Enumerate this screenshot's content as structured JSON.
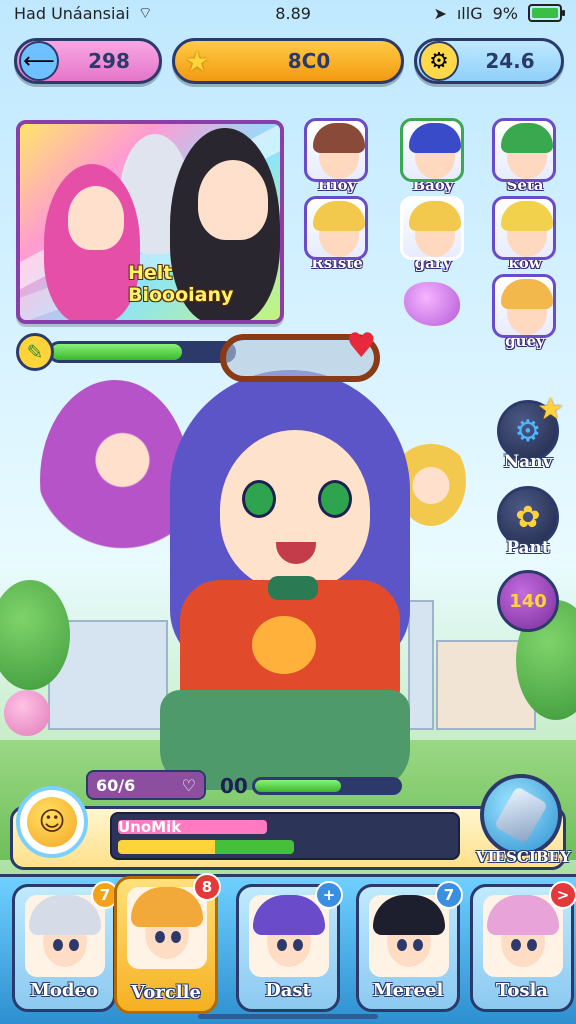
{
  "status_bar": {
    "carrier": "Had Unáansiai",
    "time": "8.89",
    "signal_text": "ıllG",
    "battery": "9%",
    "wifi_icon": "wifi-icon",
    "location_icon": "location-arrow-icon"
  },
  "resources": [
    {
      "icon": "arrow-left-icon",
      "value": "298"
    },
    {
      "icon": "star-icon",
      "value": "8C0"
    },
    {
      "icon": "gear-coin-icon",
      "value": "24.6"
    }
  ],
  "featured": {
    "caption": "Helt Bioooiany"
  },
  "roster": [
    {
      "label": "Hioy",
      "hair": "#8a4a3a",
      "border": "#6a4bc9"
    },
    {
      "label": "Baoy",
      "hair": "#3a4bc9",
      "border": "#3aa84f"
    },
    {
      "label": "Seta",
      "hair": "#3aa84f",
      "border": "#6a4bc9"
    },
    {
      "label": "Rsiste",
      "hair": "#f2c94c",
      "border": "#6a4bc9"
    },
    {
      "label": "gary",
      "hair": "#f2c94c",
      "border": "#fff"
    },
    {
      "label": "kow",
      "hair": "#f2d24c",
      "border": "#6a4bc9"
    },
    {
      "label": "guey",
      "hair": "#f2b84c",
      "border": "#6a4bc9"
    }
  ],
  "progress": {
    "fill_fraction": 0.72
  },
  "side_menu": [
    {
      "label": "Nanv",
      "icon": "gear-icon"
    },
    {
      "label": "Pant",
      "icon": "brush-icon"
    },
    {
      "label": "",
      "icon": "coin-icon",
      "coin_text": "140"
    }
  ],
  "player": {
    "hp_text": "60/6",
    "exp_num": "00",
    "exp_fill_fraction": 0.6
  },
  "quest": {
    "title": "UnoMik",
    "pink_fraction": 0.48,
    "progress_fraction": 0.55
  },
  "vs_button": {
    "label": "VIESCIBEY"
  },
  "team": [
    {
      "name": "Modeo",
      "badge": "7",
      "badge_color": "#f3a21a",
      "hair": "#d6dbe8"
    },
    {
      "name": "Vorclle",
      "badge": "8",
      "badge_color": "#e23a3a",
      "hair": "#f2a93a"
    },
    {
      "name": "Dast",
      "badge": "+",
      "badge_color": "#3a8fe0",
      "hair": "#6a4bc9"
    },
    {
      "name": "Mereel",
      "badge": "7",
      "badge_color": "#3a8fe0",
      "hair": "#1d1f2e"
    },
    {
      "name": "Tosla",
      "badge": ">",
      "badge_color": "#e23a3a",
      "hair": "#e8a3d8"
    }
  ],
  "colors": {
    "outline": "#2b3a6b",
    "accent_gold": "#ffd43b",
    "exp_green": "#3ab82c"
  }
}
